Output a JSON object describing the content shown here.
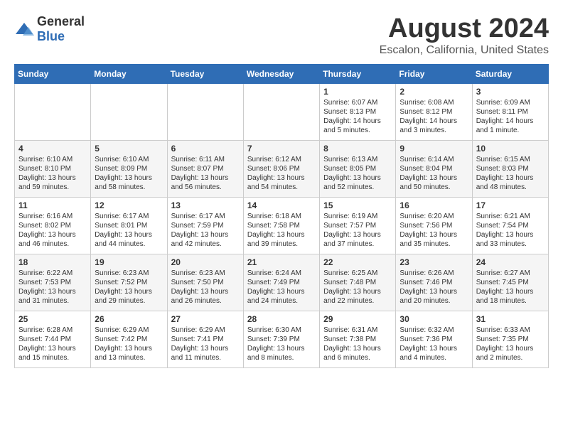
{
  "logo": {
    "text_general": "General",
    "text_blue": "Blue"
  },
  "title": "August 2024",
  "subtitle": "Escalon, California, United States",
  "days_of_week": [
    "Sunday",
    "Monday",
    "Tuesday",
    "Wednesday",
    "Thursday",
    "Friday",
    "Saturday"
  ],
  "weeks": [
    [
      {
        "day": "",
        "content": ""
      },
      {
        "day": "",
        "content": ""
      },
      {
        "day": "",
        "content": ""
      },
      {
        "day": "",
        "content": ""
      },
      {
        "day": "1",
        "content": "Sunrise: 6:07 AM\nSunset: 8:13 PM\nDaylight: 14 hours\nand 5 minutes."
      },
      {
        "day": "2",
        "content": "Sunrise: 6:08 AM\nSunset: 8:12 PM\nDaylight: 14 hours\nand 3 minutes."
      },
      {
        "day": "3",
        "content": "Sunrise: 6:09 AM\nSunset: 8:11 PM\nDaylight: 14 hours\nand 1 minute."
      }
    ],
    [
      {
        "day": "4",
        "content": "Sunrise: 6:10 AM\nSunset: 8:10 PM\nDaylight: 13 hours\nand 59 minutes."
      },
      {
        "day": "5",
        "content": "Sunrise: 6:10 AM\nSunset: 8:09 PM\nDaylight: 13 hours\nand 58 minutes."
      },
      {
        "day": "6",
        "content": "Sunrise: 6:11 AM\nSunset: 8:07 PM\nDaylight: 13 hours\nand 56 minutes."
      },
      {
        "day": "7",
        "content": "Sunrise: 6:12 AM\nSunset: 8:06 PM\nDaylight: 13 hours\nand 54 minutes."
      },
      {
        "day": "8",
        "content": "Sunrise: 6:13 AM\nSunset: 8:05 PM\nDaylight: 13 hours\nand 52 minutes."
      },
      {
        "day": "9",
        "content": "Sunrise: 6:14 AM\nSunset: 8:04 PM\nDaylight: 13 hours\nand 50 minutes."
      },
      {
        "day": "10",
        "content": "Sunrise: 6:15 AM\nSunset: 8:03 PM\nDaylight: 13 hours\nand 48 minutes."
      }
    ],
    [
      {
        "day": "11",
        "content": "Sunrise: 6:16 AM\nSunset: 8:02 PM\nDaylight: 13 hours\nand 46 minutes."
      },
      {
        "day": "12",
        "content": "Sunrise: 6:17 AM\nSunset: 8:01 PM\nDaylight: 13 hours\nand 44 minutes."
      },
      {
        "day": "13",
        "content": "Sunrise: 6:17 AM\nSunset: 7:59 PM\nDaylight: 13 hours\nand 42 minutes."
      },
      {
        "day": "14",
        "content": "Sunrise: 6:18 AM\nSunset: 7:58 PM\nDaylight: 13 hours\nand 39 minutes."
      },
      {
        "day": "15",
        "content": "Sunrise: 6:19 AM\nSunset: 7:57 PM\nDaylight: 13 hours\nand 37 minutes."
      },
      {
        "day": "16",
        "content": "Sunrise: 6:20 AM\nSunset: 7:56 PM\nDaylight: 13 hours\nand 35 minutes."
      },
      {
        "day": "17",
        "content": "Sunrise: 6:21 AM\nSunset: 7:54 PM\nDaylight: 13 hours\nand 33 minutes."
      }
    ],
    [
      {
        "day": "18",
        "content": "Sunrise: 6:22 AM\nSunset: 7:53 PM\nDaylight: 13 hours\nand 31 minutes."
      },
      {
        "day": "19",
        "content": "Sunrise: 6:23 AM\nSunset: 7:52 PM\nDaylight: 13 hours\nand 29 minutes."
      },
      {
        "day": "20",
        "content": "Sunrise: 6:23 AM\nSunset: 7:50 PM\nDaylight: 13 hours\nand 26 minutes."
      },
      {
        "day": "21",
        "content": "Sunrise: 6:24 AM\nSunset: 7:49 PM\nDaylight: 13 hours\nand 24 minutes."
      },
      {
        "day": "22",
        "content": "Sunrise: 6:25 AM\nSunset: 7:48 PM\nDaylight: 13 hours\nand 22 minutes."
      },
      {
        "day": "23",
        "content": "Sunrise: 6:26 AM\nSunset: 7:46 PM\nDaylight: 13 hours\nand 20 minutes."
      },
      {
        "day": "24",
        "content": "Sunrise: 6:27 AM\nSunset: 7:45 PM\nDaylight: 13 hours\nand 18 minutes."
      }
    ],
    [
      {
        "day": "25",
        "content": "Sunrise: 6:28 AM\nSunset: 7:44 PM\nDaylight: 13 hours\nand 15 minutes."
      },
      {
        "day": "26",
        "content": "Sunrise: 6:29 AM\nSunset: 7:42 PM\nDaylight: 13 hours\nand 13 minutes."
      },
      {
        "day": "27",
        "content": "Sunrise: 6:29 AM\nSunset: 7:41 PM\nDaylight: 13 hours\nand 11 minutes."
      },
      {
        "day": "28",
        "content": "Sunrise: 6:30 AM\nSunset: 7:39 PM\nDaylight: 13 hours\nand 8 minutes."
      },
      {
        "day": "29",
        "content": "Sunrise: 6:31 AM\nSunset: 7:38 PM\nDaylight: 13 hours\nand 6 minutes."
      },
      {
        "day": "30",
        "content": "Sunrise: 6:32 AM\nSunset: 7:36 PM\nDaylight: 13 hours\nand 4 minutes."
      },
      {
        "day": "31",
        "content": "Sunrise: 6:33 AM\nSunset: 7:35 PM\nDaylight: 13 hours\nand 2 minutes."
      }
    ]
  ]
}
